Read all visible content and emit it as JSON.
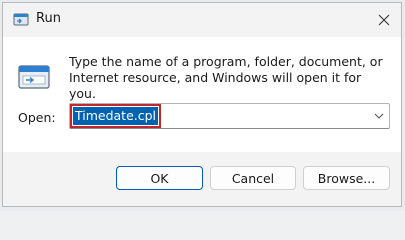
{
  "window": {
    "title": "Run",
    "close_icon": "close-icon",
    "app_icon": "run-app-icon"
  },
  "content": {
    "icon": "run-program-icon",
    "description": "Type the name of a program, folder, document, or Internet resource, and Windows will open it for you.",
    "open_label": "Open:",
    "open_value": "Timedate.cpl",
    "dropdown_icon": "chevron-down-icon"
  },
  "buttons": {
    "ok": "OK",
    "cancel": "Cancel",
    "browse": "Browse..."
  },
  "colors": {
    "accent": "#005fb8",
    "selection": "#0063b1",
    "highlight_border": "#c4262e"
  }
}
